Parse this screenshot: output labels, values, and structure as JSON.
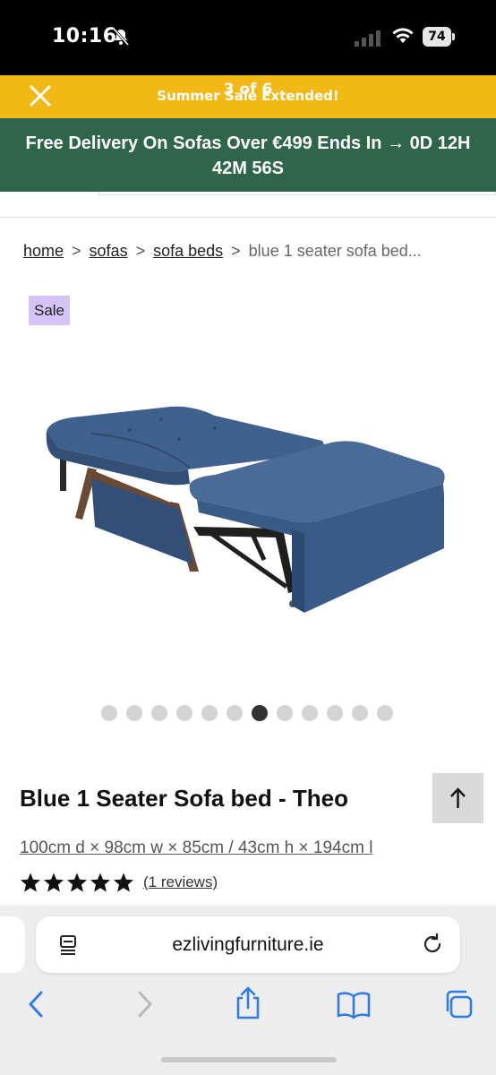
{
  "status_bar": {
    "time": "10:16",
    "battery": "74"
  },
  "promo": {
    "text": "Summer Sale Extended!",
    "gallery_counter": "3 of 6"
  },
  "delivery": {
    "text": "Free Delivery On Sofas Over €499 Ends In → 0D 12H 42M 56S"
  },
  "breadcrumb": {
    "home": "home",
    "sofas": "sofas",
    "sofa_beds": "sofa beds",
    "current": "blue 1 seater sofa bed...",
    "separator": ">"
  },
  "product": {
    "badge": "Sale",
    "title": "Blue 1 Seater Sofa bed - Theo",
    "dimensions": "100cm d × 98cm w × 85cm / 43cm h × 194cm l",
    "rating": 5,
    "reviews": "(1 reviews)",
    "image_colors": {
      "fabric": "#3e5b87",
      "wood": "#6b4a34"
    }
  },
  "carousel": {
    "count": 12,
    "active_index": 6
  },
  "browser": {
    "url": "ezlivingfurniture.ie"
  },
  "colors": {
    "promo_yellow": "#f2b816",
    "delivery_green": "#2f654b",
    "sale_purple": "#d4c4f5",
    "ios_blue": "#2f7de1"
  }
}
